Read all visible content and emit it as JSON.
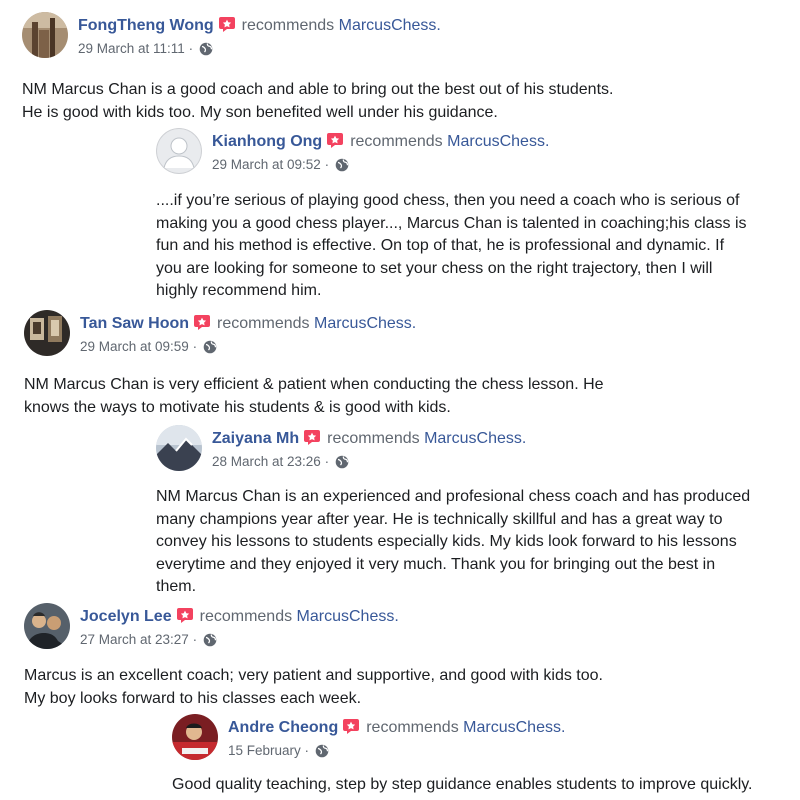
{
  "reviews": [
    {
      "name": "FongTheng Wong",
      "verb": "recommends",
      "page": "MarcusChess.",
      "date": "29 March at 11:11",
      "separator": " · ",
      "text": "NM Marcus Chan is a good coach and able to bring out the best out of his students.\nHe is good with kids too. My son benefited well under his guidance."
    },
    {
      "name": "Kianhong Ong",
      "verb": "recommends",
      "page": "MarcusChess.",
      "date": "29 March at 09:52",
      "separator": " · ",
      "text": "....if you’re serious of playing good chess, then you need a coach who is serious of\nmaking you a good chess player..., Marcus Chan is talented in coaching;his class is\nfun and his method is effective. On top of that, he is professional and dynamic. If\nyou are looking for someone to set your chess on the right trajectory, then I will\nhighly recommend him."
    },
    {
      "name": "Tan Saw Hoon",
      "verb": "recommends",
      "page": "MarcusChess.",
      "date": "29 March at 09:59",
      "separator": " · ",
      "text": "NM Marcus Chan is very efficient & patient when conducting the chess lesson. He\nknows the ways to motivate his students & is good with kids."
    },
    {
      "name": "Zaiyana Mh",
      "verb": "recommends",
      "page": "MarcusChess.",
      "date": "28 March at 23:26",
      "separator": " · ",
      "text": "NM Marcus Chan is an experienced and profesional chess coach and has produced\nmany champions year after year. He is technically skillful and has a great way to\nconvey his lessons to students especially kids. My kids look forward to his lessons\neverytime and they enjoyed it very much. Thank you for bringing out the best in\nthem."
    },
    {
      "name": "Jocelyn Lee",
      "verb": "recommends",
      "page": "MarcusChess.",
      "date": "27 March at 23:27",
      "separator": " · ",
      "text": "Marcus is an excellent coach; very patient and supportive, and good with kids too.\nMy boy looks forward to his classes each week."
    },
    {
      "name": "Andre Cheong",
      "verb": "recommends",
      "page": "MarcusChess.",
      "date": "15 February",
      "separator": " · ",
      "text": "Good quality teaching, step by step guidance enables students to improve quickly."
    }
  ],
  "icons": {
    "recommend_badge": "recommend-badge-icon",
    "audience": "globe-icon"
  },
  "colors": {
    "name_link": "#385898",
    "meta_grey": "#606770",
    "badge_red": "#f3425f",
    "body_text": "#1c1e21"
  }
}
